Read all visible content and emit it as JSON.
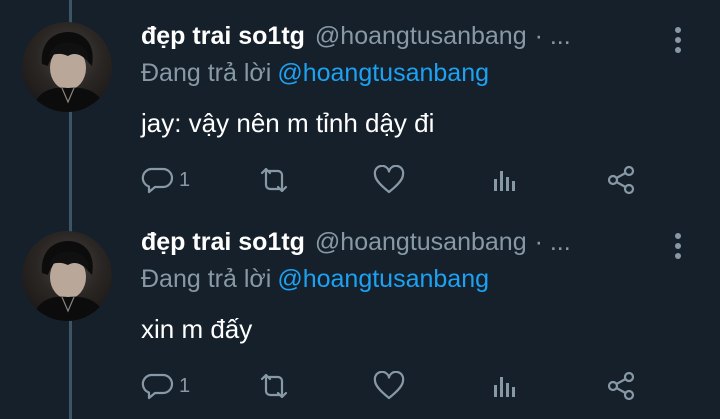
{
  "tweets": [
    {
      "display_name": "đẹp trai so1tg",
      "handle": "@hoangtusanbang",
      "separator": "· ...",
      "reply_prefix": "Đang trả lời",
      "reply_to": "@hoangtusanbang",
      "text": "jay: vậy nên m tỉnh dậy đi",
      "reply_count": "1"
    },
    {
      "display_name": "đẹp trai so1tg",
      "handle": "@hoangtusanbang",
      "separator": "· ...",
      "reply_prefix": "Đang trả lời",
      "reply_to": "@hoangtusanbang",
      "text": "xin m đấy",
      "reply_count": "1"
    }
  ],
  "icons": {
    "reply": "reply-icon",
    "retweet": "retweet-icon",
    "like": "heart-icon",
    "analytics": "analytics-icon",
    "share": "share-icon",
    "more": "more-vertical-icon"
  },
  "colors": {
    "background": "#15202b",
    "text_primary": "#ffffff",
    "text_secondary": "#8899a6",
    "link": "#1da1f2",
    "thread_line": "#3d5466"
  }
}
